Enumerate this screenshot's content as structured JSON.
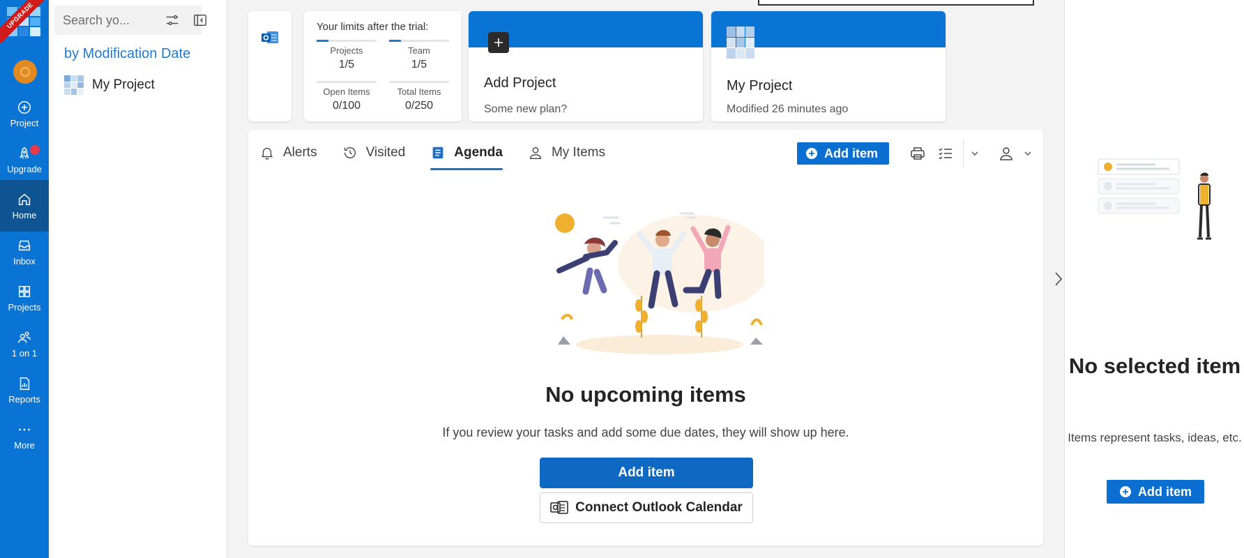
{
  "colors": {
    "brand": "#0a74d4",
    "rail_active": "#0f5593",
    "accent": "#1f7ad0",
    "badge": "#e53b4b",
    "ribbon": "#d11b1b"
  },
  "logo": {
    "ribbon_text": "UPGRADE"
  },
  "rail": {
    "items": [
      {
        "label": "Project",
        "icon": "plus-circle-icon"
      },
      {
        "label": "Upgrade",
        "icon": "rocket-icon"
      },
      {
        "label": "Home",
        "icon": "home-icon"
      },
      {
        "label": "Inbox",
        "icon": "inbox-icon"
      },
      {
        "label": "Projects",
        "icon": "grid-icon"
      },
      {
        "label": "1 on 1",
        "icon": "people-icon"
      },
      {
        "label": "Reports",
        "icon": "report-icon"
      },
      {
        "label": "More",
        "icon": "more-icon"
      }
    ]
  },
  "sidebar": {
    "search_placeholder": "Search yo...",
    "sort_label": "by Modification Date",
    "projects": [
      {
        "name": "My Project"
      }
    ]
  },
  "limits": {
    "title": "Your limits after the trial:",
    "items": [
      {
        "name": "Projects",
        "value": "1/5",
        "fraction": 0.2
      },
      {
        "name": "Team",
        "value": "1/5",
        "fraction": 0.2
      },
      {
        "name": "Open Items",
        "value": "0/100",
        "fraction": 0
      },
      {
        "name": "Total Items",
        "value": "0/250",
        "fraction": 0
      }
    ]
  },
  "cards": {
    "add_project": {
      "title": "Add Project",
      "subtitle": "Some new plan?"
    },
    "my_project": {
      "title": "My Project",
      "subtitle": "Modified 26 minutes ago"
    }
  },
  "tabs": [
    {
      "label": "Alerts",
      "icon": "bell-icon"
    },
    {
      "label": "Visited",
      "icon": "history-icon"
    },
    {
      "label": "Agenda",
      "icon": "agenda-icon",
      "active": true
    },
    {
      "label": "My Items",
      "icon": "person-icon"
    }
  ],
  "toolbar": {
    "add_item_label": "Add item"
  },
  "empty_state": {
    "title": "No upcoming items",
    "description": "If you review your tasks and add some due dates, they will show up here.",
    "add_button": "Add item",
    "outlook_button": "Connect Outlook Calendar"
  },
  "right_panel": {
    "title": "No selected item",
    "description": "Items represent tasks, ideas, etc.",
    "add_button": "Add item"
  }
}
